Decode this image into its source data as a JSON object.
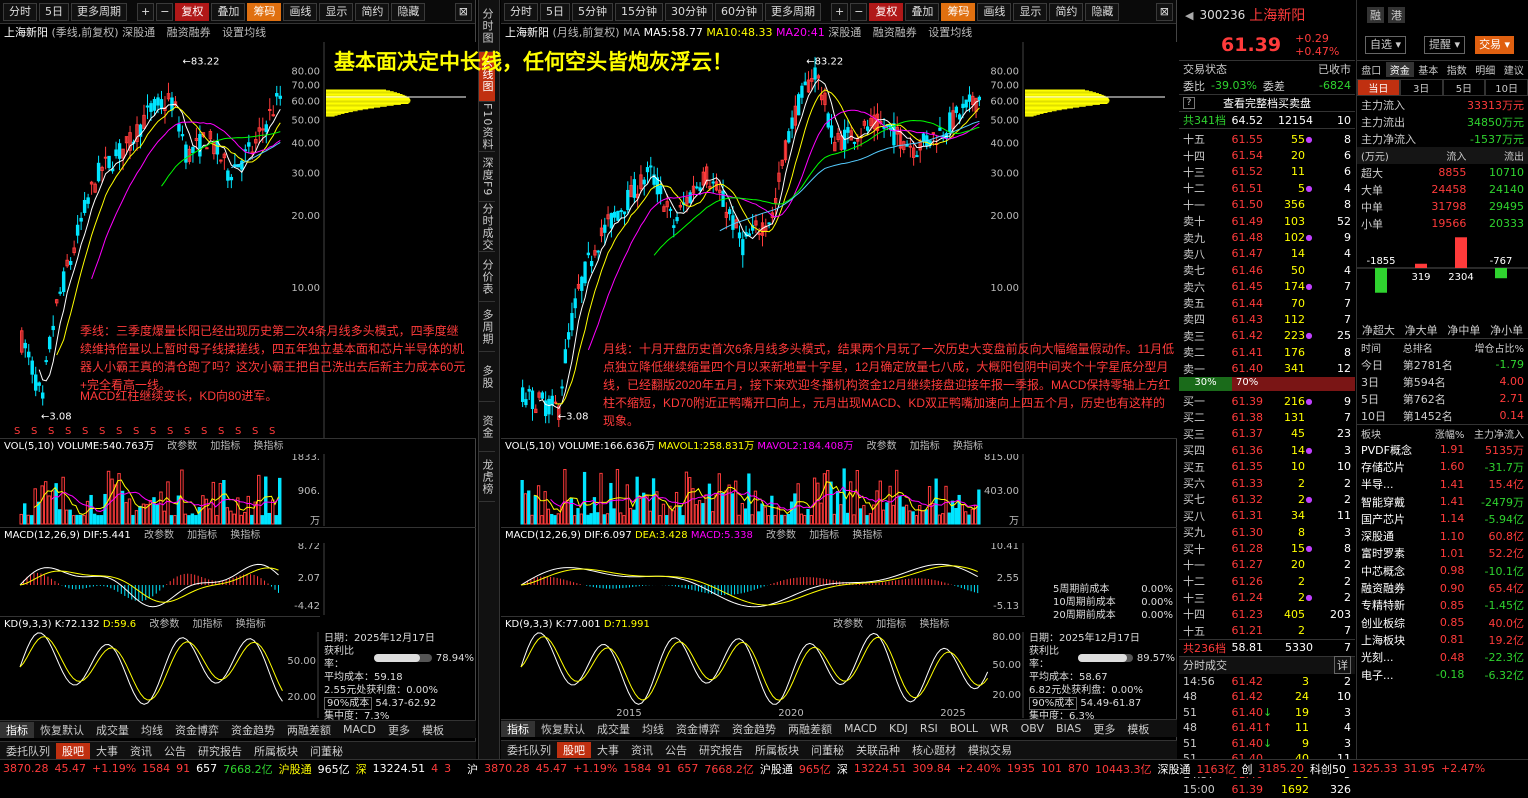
{
  "left_toolbar": {
    "items": [
      "分时",
      "5日",
      "更多周期",
      "|",
      "+",
      "−",
      "复权",
      "叠加",
      "筹码",
      "画线",
      "显示",
      "简约",
      "隐藏"
    ]
  },
  "mid_toolbar": {
    "items": [
      "分时",
      "5日",
      "5分钟",
      "15分钟",
      "30分钟",
      "60分钟",
      "更多周期",
      "|",
      "+",
      "−",
      "复权",
      "叠加",
      "筹码",
      "画线",
      "显示",
      "简约",
      "隐藏"
    ]
  },
  "headline": "基本面决定中长线，任何空头皆炮灰浮云！",
  "left_chart": {
    "title_name": "上海新阳",
    "title_period": "(季线,前复权)",
    "title_tabs": [
      "深股通",
      "融资融券",
      "设置均线"
    ],
    "y_labels": [
      "80.00",
      "70.00",
      "60.00",
      "50.00",
      "40.00",
      "30.00",
      "20.00",
      "10.00"
    ],
    "high_label": "83.22",
    "low_label": "3.08",
    "annotation": "季线：三季度爆量长阳已经出现历史第二次4条月线多头模式，四季度继续维持倍量以上暂时母子线揉搓线，四五年独立基本面和芯片半导体的机器人小霸王真的清仓跑了吗？这次小霸王把自己洗出去后新主力成本60元+完全看高一线。",
    "annotation2": "MACD红柱继续变长，KD向80进军。",
    "vol_header": {
      "a": "VOL(5,10)",
      "b": "VOLUME:540.763万",
      "d": "改参数",
      "e": "加指标",
      "f": "换指标"
    },
    "vol_y": [
      "1833.",
      "906.",
      "万"
    ],
    "macd_header": {
      "a": "MACD(12,26,9)",
      "b": "DIF:5.441",
      "d": "改参数",
      "e": "加指标",
      "f": "换指标"
    },
    "macd_y": [
      "8.72",
      "2.07",
      "-4.42"
    ],
    "kd_header": {
      "a": "KD(9,3,3)",
      "b": "K:72.132",
      "c": "D:59.6",
      "d": "改参数",
      "e": "加指标",
      "f": "换指标"
    },
    "kd_y": [
      "50.00",
      "20.00"
    ],
    "info": {
      "date": "日期：2025年12月17日",
      "profit_label": "获利比率：",
      "profit": "78.94%",
      "avg": "平均成本：59.18",
      "range1": "2.55元处获利盘：0.00%",
      "cost_sel": "90%成本",
      "cost_range": "54.37-62.92",
      "conc": "集中度：7.3%"
    },
    "tabs": [
      "指标",
      "恢复默认",
      "成交量",
      "均线",
      "资金博弈",
      "资金趋势",
      "两融差额",
      "MACD",
      "更多",
      "模板"
    ]
  },
  "mid_chart": {
    "title_name": "上海新阳",
    "title_period": "(月线,前复权)",
    "ma": [
      "MA",
      "MA5:58.77",
      "MA10:48.33",
      "MA20:41"
    ],
    "title_tabs": [
      "深股通",
      "融资融券",
      "设置均线"
    ],
    "y_labels": [
      "80.00",
      "70.00",
      "60.00",
      "50.00",
      "40.00",
      "30.00",
      "20.00",
      "10.00"
    ],
    "high_label": "83.22",
    "low_label": "3.08",
    "annotation": "月线：十月开盘历史首次6条月线多头模式，结果两个月玩了一次历史大变盘前反向大幅缩量假动作。11月低点独立降低继续缩量四个月以来新地量十字星，12月确定放量七八成，大概阳包阴中间夹个十字星底分型月线，已经翻版2020年五月，接下来欢迎冬播机构资金12月继续接盘迎接年报一季报。MACD保持零轴上方红柱不缩短，KD70附近正鸭嘴开口向上，元月出现MACD、KD双正鸭嘴加速向上四五个月，历史也有这样的现象。",
    "vol_header": {
      "a": "VOL(5,10)",
      "b": "VOLUME:166.636万",
      "c": "MAVOL1:258.831万",
      "c2": "MAVOL2:184.408万",
      "d": "改参数",
      "e": "加指标",
      "f": "换指标"
    },
    "vol_y": [
      "815.00",
      "403.00",
      "万"
    ],
    "macd_header": {
      "a": "MACD(12,26,9)",
      "b": "DIF:6.097",
      "c": "DEA:3.428",
      "c2": "MACD:5.338",
      "d": "改参数",
      "e": "加指标",
      "f": "换指标"
    },
    "macd_y": [
      "10.41",
      "2.55",
      "-5.13"
    ],
    "cost_legend": [
      [
        "5周期前成本",
        "0.00%"
      ],
      [
        "10周期前成本",
        "0.00%"
      ],
      [
        "20周期前成本",
        "0.00%"
      ]
    ],
    "kd_header": {
      "a": "KD(9,3,3)",
      "b": "K:77.001",
      "c": "D:71.991",
      "d": "改参数",
      "e": "加指标",
      "f": "换指标"
    },
    "kd_y": [
      "80.00",
      "50.00",
      "20.00"
    ],
    "x_labels": [
      "2015",
      "2020",
      "2025"
    ],
    "info": {
      "date": "日期：2025年12月17日",
      "profit_label": "获利比率：",
      "profit": "89.57%",
      "avg": "平均成本：58.67",
      "range1": "6.82元处获利盘：0.00%",
      "cost_sel": "90%成本",
      "cost_range": "54.49-61.87",
      "conc": "集中度：6.3%"
    },
    "tabs": [
      "指标",
      "恢复默认",
      "成交量",
      "均线",
      "资金博弈",
      "资金趋势",
      "两融差额",
      "MACD",
      "KDJ",
      "RSI",
      "BOLL",
      "WR",
      "OBV",
      "BIAS",
      "更多",
      "模板"
    ]
  },
  "sidebar": [
    "分时图",
    "K线图",
    "F10资料",
    "深度F9",
    "分时成交",
    "分价表",
    "多周期",
    "多股",
    "资金",
    "龙虎榜"
  ],
  "bottom_tabs": [
    "委托队列",
    "股吧",
    "大事",
    "资讯",
    "公告",
    "研究报告",
    "所属板块",
    "问董秘",
    "关联品种",
    "核心题材",
    "模拟交易"
  ],
  "stock": {
    "code": "300236",
    "name": "上海新阳",
    "price": "61.39",
    "change": "+0.29",
    "pct": "+0.47%",
    "btn1": "融",
    "btn2": "港",
    "add": "自选",
    "remind": "提醒",
    "trade": "交易"
  },
  "quote": {
    "state_label": "交易状态",
    "state": "已收市",
    "wb_label": "委比",
    "wb": "-39.03%",
    "wc_label": "委差",
    "wc": "-6824",
    "full": "查看完整档买卖盘",
    "total_sell": {
      "label": "共341档",
      "price": "64.52",
      "vol": "12154",
      "n": "10"
    },
    "sells": [
      [
        "十五",
        "61.55",
        "55",
        "8"
      ],
      [
        "十四",
        "61.54",
        "20",
        "6"
      ],
      [
        "十三",
        "61.52",
        "11",
        "6"
      ],
      [
        "十二",
        "61.51",
        "5",
        "4"
      ],
      [
        "十一",
        "61.50",
        "356",
        "8"
      ],
      [
        "卖十",
        "61.49",
        "103",
        "52"
      ],
      [
        "卖九",
        "61.48",
        "102",
        "9"
      ],
      [
        "卖八",
        "61.47",
        "14",
        "4"
      ],
      [
        "卖七",
        "61.46",
        "50",
        "4"
      ],
      [
        "卖六",
        "61.45",
        "174",
        "7"
      ],
      [
        "卖五",
        "61.44",
        "70",
        "7"
      ],
      [
        "卖四",
        "61.43",
        "112",
        "7"
      ],
      [
        "卖三",
        "61.42",
        "223",
        "25"
      ],
      [
        "卖二",
        "61.41",
        "176",
        "8"
      ],
      [
        "卖一",
        "61.40",
        "341",
        "12"
      ]
    ],
    "ratio": {
      "left": "30%",
      "right": "70%"
    },
    "buys": [
      [
        "买一",
        "61.39",
        "216",
        "9"
      ],
      [
        "买二",
        "61.38",
        "131",
        "7"
      ],
      [
        "买三",
        "61.37",
        "45",
        "23"
      ],
      [
        "买四",
        "61.36",
        "14",
        "3"
      ],
      [
        "买五",
        "61.35",
        "10",
        "10"
      ],
      [
        "买六",
        "61.33",
        "2",
        "2"
      ],
      [
        "买七",
        "61.32",
        "2",
        "2"
      ],
      [
        "买八",
        "61.31",
        "34",
        "11"
      ],
      [
        "买九",
        "61.30",
        "8",
        "3"
      ],
      [
        "买十",
        "61.28",
        "15",
        "8"
      ],
      [
        "十一",
        "61.27",
        "20",
        "2"
      ],
      [
        "十二",
        "61.26",
        "2",
        "2"
      ],
      [
        "十三",
        "61.24",
        "2",
        "2"
      ],
      [
        "十四",
        "61.23",
        "405",
        "203"
      ],
      [
        "十五",
        "61.21",
        "2",
        "7"
      ]
    ],
    "total_buy": {
      "label": "共236档",
      "price": "58.81",
      "vol": "5330",
      "n": "7"
    }
  },
  "ticks": {
    "title": "分时成交",
    "detail": "详",
    "rows": [
      [
        "14:56",
        "61.42",
        "3",
        "2",
        ""
      ],
      [
        "48",
        "61.42",
        "24",
        "10",
        ""
      ],
      [
        "51",
        "61.40",
        "19",
        "3",
        "↓"
      ],
      [
        "48",
        "61.41",
        "11",
        "4",
        "↑"
      ],
      [
        "51",
        "61.40",
        "9",
        "3",
        "↓"
      ],
      [
        "51",
        "61.40",
        "40",
        "11",
        ""
      ],
      [
        "14:57",
        "61.40",
        "18",
        "5",
        ""
      ],
      [
        "15:00",
        "61.39",
        "1692",
        "326",
        ""
      ]
    ]
  },
  "fund": {
    "tabs": [
      "盘口",
      "资金",
      "基本",
      "指数",
      "明细",
      "建议"
    ],
    "sub": [
      "当日",
      "3日",
      "5日",
      "10日"
    ],
    "main": [
      [
        "主力流入",
        "33313万元"
      ],
      [
        "主力流出",
        "34850万元"
      ],
      [
        "主力净流入",
        "-1537万元"
      ]
    ],
    "head": [
      "(万元)",
      "流入",
      "流出"
    ],
    "rows": [
      [
        "超大",
        "8855",
        "10710"
      ],
      [
        "大单",
        "24458",
        "24140"
      ],
      [
        "中单",
        "31798",
        "29495"
      ],
      [
        "小单",
        "19566",
        "20333"
      ]
    ],
    "bars": [
      {
        "label": "-1855",
        "v": -1855
      },
      {
        "label": "319",
        "v": 319
      },
      {
        "label": "2304",
        "v": 2304
      },
      {
        "label": "-767",
        "v": -767
      }
    ],
    "bar_labels": [
      "净超大",
      "净大单",
      "净中单",
      "净小单"
    ],
    "rank_head": [
      "时间",
      "总排名",
      "增仓占比%"
    ],
    "rank": [
      [
        "今日",
        "第2781名",
        "-1.79"
      ],
      [
        "3日",
        "第594名",
        "4.00"
      ],
      [
        "5日",
        "第762名",
        "2.71"
      ],
      [
        "10日",
        "第1452名",
        "0.14"
      ]
    ],
    "sect_head": [
      "板块",
      "涨幅%",
      "主力净流入"
    ],
    "sectors": [
      [
        "PVDF概念",
        "1.91",
        "5135万"
      ],
      [
        "存储芯片",
        "1.60",
        "-31.7万"
      ],
      [
        "半导...",
        "1.41",
        "15.4亿"
      ],
      [
        "智能穿戴",
        "1.41",
        "-2479万"
      ],
      [
        "国产芯片",
        "1.14",
        "-5.94亿"
      ],
      [
        "深股通",
        "1.10",
        "60.8亿"
      ],
      [
        "富时罗素",
        "1.01",
        "52.2亿"
      ],
      [
        "中芯概念",
        "0.98",
        "-10.1亿"
      ],
      [
        "融资融券",
        "0.90",
        "65.4亿"
      ],
      [
        "专精特新",
        "0.85",
        "-1.45亿"
      ],
      [
        "创业板综",
        "0.85",
        "40.0亿"
      ],
      [
        "上海板块",
        "0.81",
        "19.2亿"
      ],
      [
        "光刻...",
        "0.48",
        "-22.3亿"
      ],
      [
        "电子...",
        "-0.18",
        "-6.32亿"
      ]
    ]
  },
  "status_left": [
    "3870.28",
    "45.47",
    "+1.19%",
    "1584",
    "91",
    "657",
    "7668.2亿",
    "沪股通",
    "965亿",
    "深",
    "13224.51",
    "4",
    "3"
  ],
  "status_mid": [
    "沪",
    "3870.28",
    "45.47",
    "+1.19%",
    "1584",
    "91",
    "657",
    "7668.2亿",
    "沪股通",
    "965亿",
    "深",
    "13224.51",
    "309.84",
    "+2.40%",
    "1935",
    "101",
    "870",
    "10443.3亿",
    "深股通",
    "1163亿",
    "创",
    "3185.20",
    "科创50",
    "1325.33",
    "31.95",
    "+2.47%"
  ]
}
